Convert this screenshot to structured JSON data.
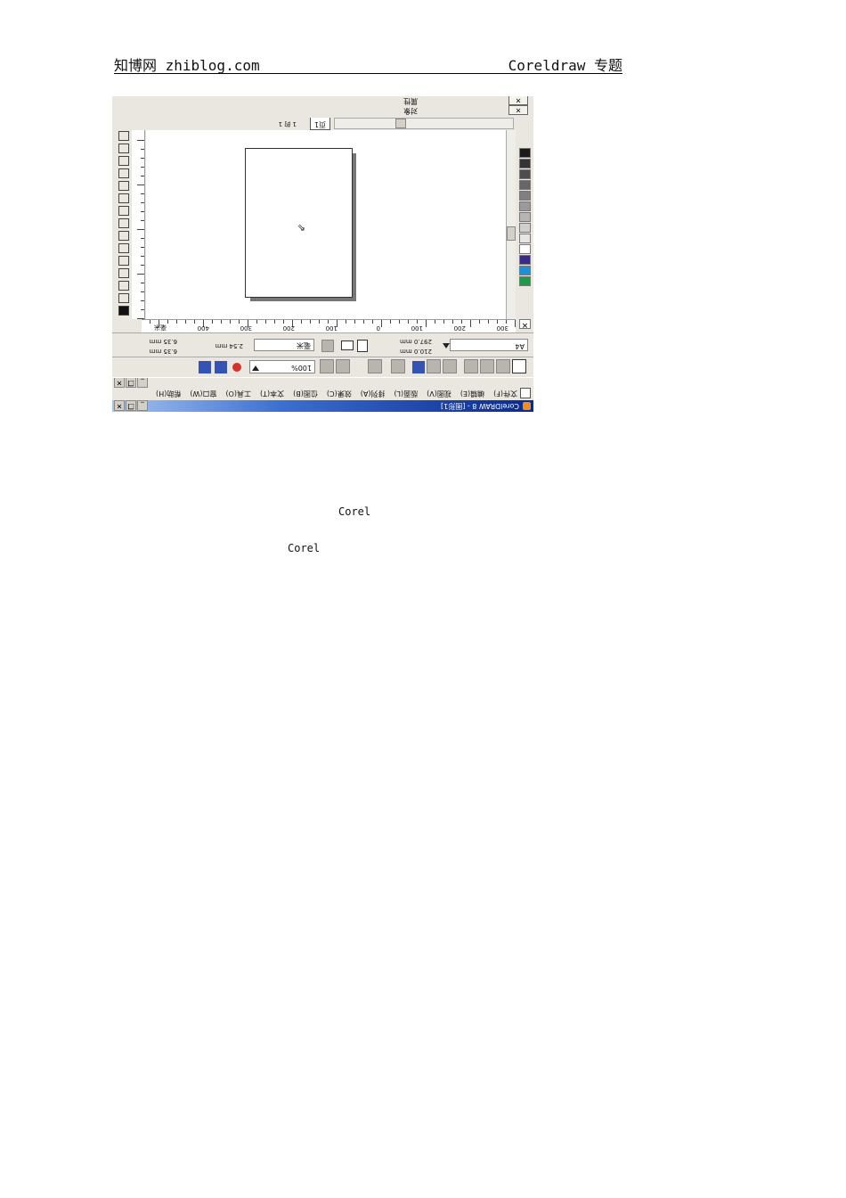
{
  "header": {
    "site": "知博网 zhiblog.com",
    "topic": "Coreldraw 专题"
  },
  "app": {
    "title": "CorelDRAW 8 - [图形1]",
    "menu": [
      "文件(F)",
      "编辑(E)",
      "视图(V)",
      "版面(L)",
      "排列(A)",
      "效果(C)",
      "位图(B)",
      "文本(T)",
      "工具(O)",
      "窗口(W)",
      "帮助(H)"
    ],
    "zoom": "100%",
    "paper": "A4",
    "page_width": "210.0 mm",
    "page_height": "297.0 mm",
    "units": "毫米",
    "nudge": "2.54 mm",
    "dup_x": "6.35 mm",
    "dup_y": "6.35 mm",
    "page_tab": "页1",
    "page_index": "1 的 1",
    "docker_items": [
      "对象",
      "属性"
    ],
    "ruler_labels": [
      "300",
      "200",
      "100",
      "0",
      "100",
      "200",
      "300",
      "400",
      "毫米"
    ],
    "swatch_colors": [
      "#1f9a4a",
      "#1e90d6",
      "#3a2a8a",
      "#ffffff",
      "#e6e6e6",
      "#cfcfcf",
      "#b5b5b5",
      "#9a9a9a",
      "#808080",
      "#666666",
      "#4d4d4d",
      "#333333",
      "#1a1a1a"
    ]
  },
  "captions": {
    "line1": "Corel",
    "line2": "Corel"
  }
}
